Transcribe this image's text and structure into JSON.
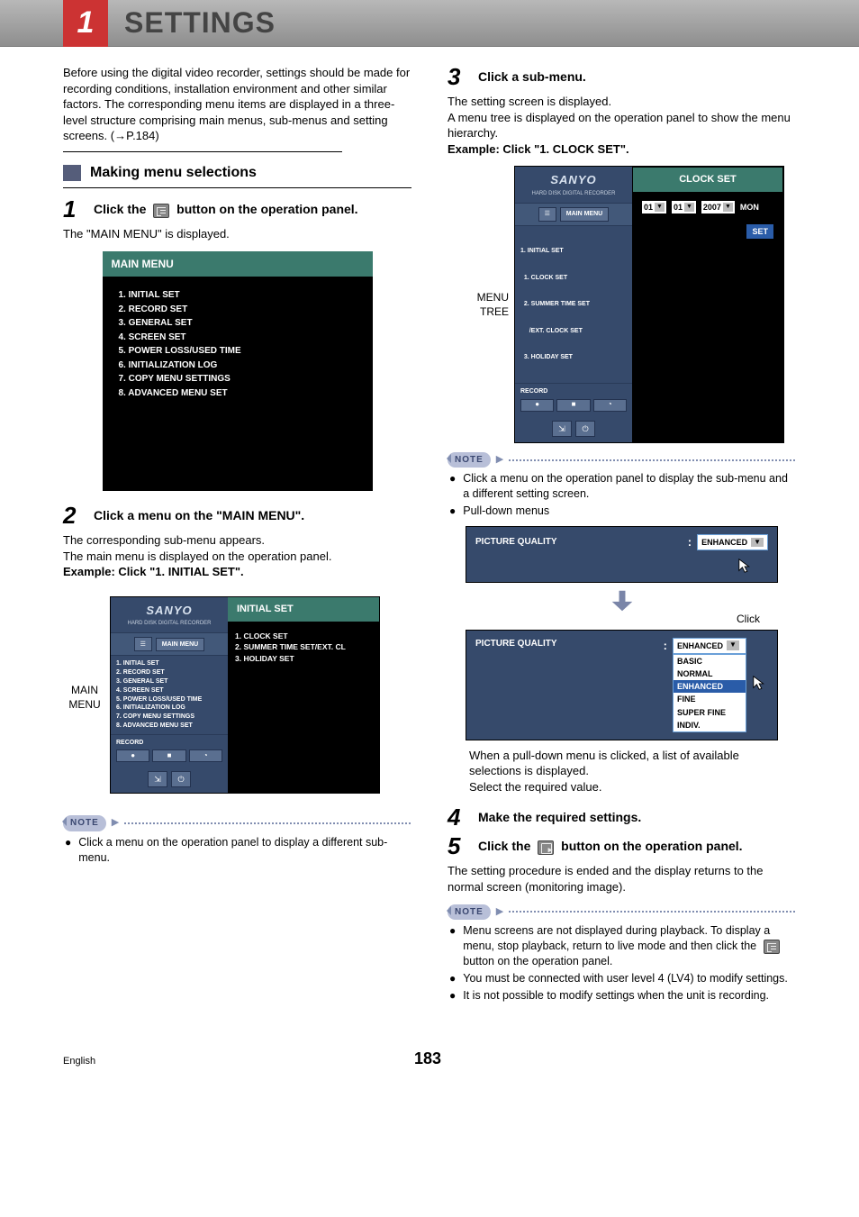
{
  "chapter_num": "1",
  "chapter_title": "SETTINGS",
  "intro": "Before using the digital video recorder, settings should be made for recording conditions, installation environment and other similar factors. The corresponding menu items are displayed in a three-level structure comprising main menus, sub-menus and setting screens. (→P.184)",
  "section_heading": "Making menu selections",
  "step1": {
    "num": "1",
    "pre": "Click the ",
    "post": " button on the operation panel.",
    "body": "The \"MAIN MENU\" is displayed."
  },
  "main_menu": {
    "header": "MAIN MENU",
    "items": [
      "1.  INITIAL SET",
      "2.  RECORD SET",
      "3.  GENERAL SET",
      "4.  SCREEN SET",
      "5.  POWER LOSS/USED TIME",
      "6.  INITIALIZATION LOG",
      "7.  COPY MENU SETTINGS",
      "8.  ADVANCED MENU SET"
    ]
  },
  "step2": {
    "num": "2",
    "head": "Click a menu on the \"MAIN MENU\".",
    "line1": "The corresponding sub-menu appears.",
    "line2": "The main menu is displayed on the operation panel.",
    "example": "Example: Click \"1. INITIAL SET\"."
  },
  "panel2": {
    "side_label_top": "MAIN",
    "side_label_bot": "MENU",
    "brand": "SANYO",
    "brand_sub": "HARD DISK DIGITAL RECORDER",
    "main_menu_label": "MAIN MENU",
    "left_items": [
      "1. INITIAL SET",
      "2. RECORD SET",
      "3. GENERAL SET",
      "4. SCREEN SET",
      "5. POWER LOSS/USED TIME",
      "6. INITIALIZATION LOG",
      "7. COPY MENU SETTINGS",
      "8. ADVANCED MENU SET"
    ],
    "record": "RECORD",
    "right_header": "INITIAL SET",
    "right_items": [
      "1.  CLOCK SET",
      "2.  SUMMER TIME SET/EXT. CL",
      "3.  HOLIDAY SET"
    ]
  },
  "note1_label": "NOTE",
  "note1_item": "Click a menu on the operation panel to display a different sub-menu.",
  "step3": {
    "num": "3",
    "head": "Click a sub-menu.",
    "line1": "The setting screen is displayed.",
    "line2": "A menu tree is displayed on the operation panel to show the menu hierarchy.",
    "example": "Example: Click \"1. CLOCK SET\"."
  },
  "panel3": {
    "side_label_top": "MENU",
    "side_label_bot": "TREE",
    "brand": "SANYO",
    "brand_sub": "HARD DISK DIGITAL RECORDER",
    "main_menu_label": "MAIN MENU",
    "left_items": [
      "1. INITIAL SET",
      "  1. CLOCK SET",
      "  2. SUMMER TIME SET",
      "     /EXT. CLOCK SET",
      "  3. HOLIDAY SET"
    ],
    "record": "RECORD",
    "right_header": "CLOCK SET",
    "dd1": "01",
    "dd2": "01",
    "dd3": "2007",
    "day": "MON",
    "set": "SET"
  },
  "note2_label": "NOTE",
  "note2_items": [
    "Click a menu on the operation panel to display the sub-menu and a different setting screen.",
    "Pull-down menus"
  ],
  "pulldown": {
    "label": "PICTURE QUALITY",
    "selected": "ENHANCED",
    "click": "Click",
    "options": [
      "BASIC",
      "NORMAL",
      "ENHANCED",
      "FINE",
      "SUPER FINE",
      "INDIV."
    ]
  },
  "pulldown_after1": "When a pull-down menu is clicked, a list of available selections is displayed.",
  "pulldown_after2": "Select the required value.",
  "step4": {
    "num": "4",
    "head": "Make the required settings."
  },
  "step5": {
    "num": "5",
    "pre": "Click the ",
    "post": " button on the operation panel.",
    "body": "The setting procedure is ended and the display returns to the normal screen (monitoring image)."
  },
  "note3_label": "NOTE",
  "note3_items": [
    {
      "pre": "Menu screens are not displayed during playback. To display a menu, stop playback, return to live mode and then click the ",
      "post": " button on the operation panel."
    },
    {
      "text": "You must be connected with user level 4 (LV4) to modify settings."
    },
    {
      "text": "It is not possible to modify settings when the unit is recording."
    }
  ],
  "footer_lang": "English",
  "footer_page": "183"
}
